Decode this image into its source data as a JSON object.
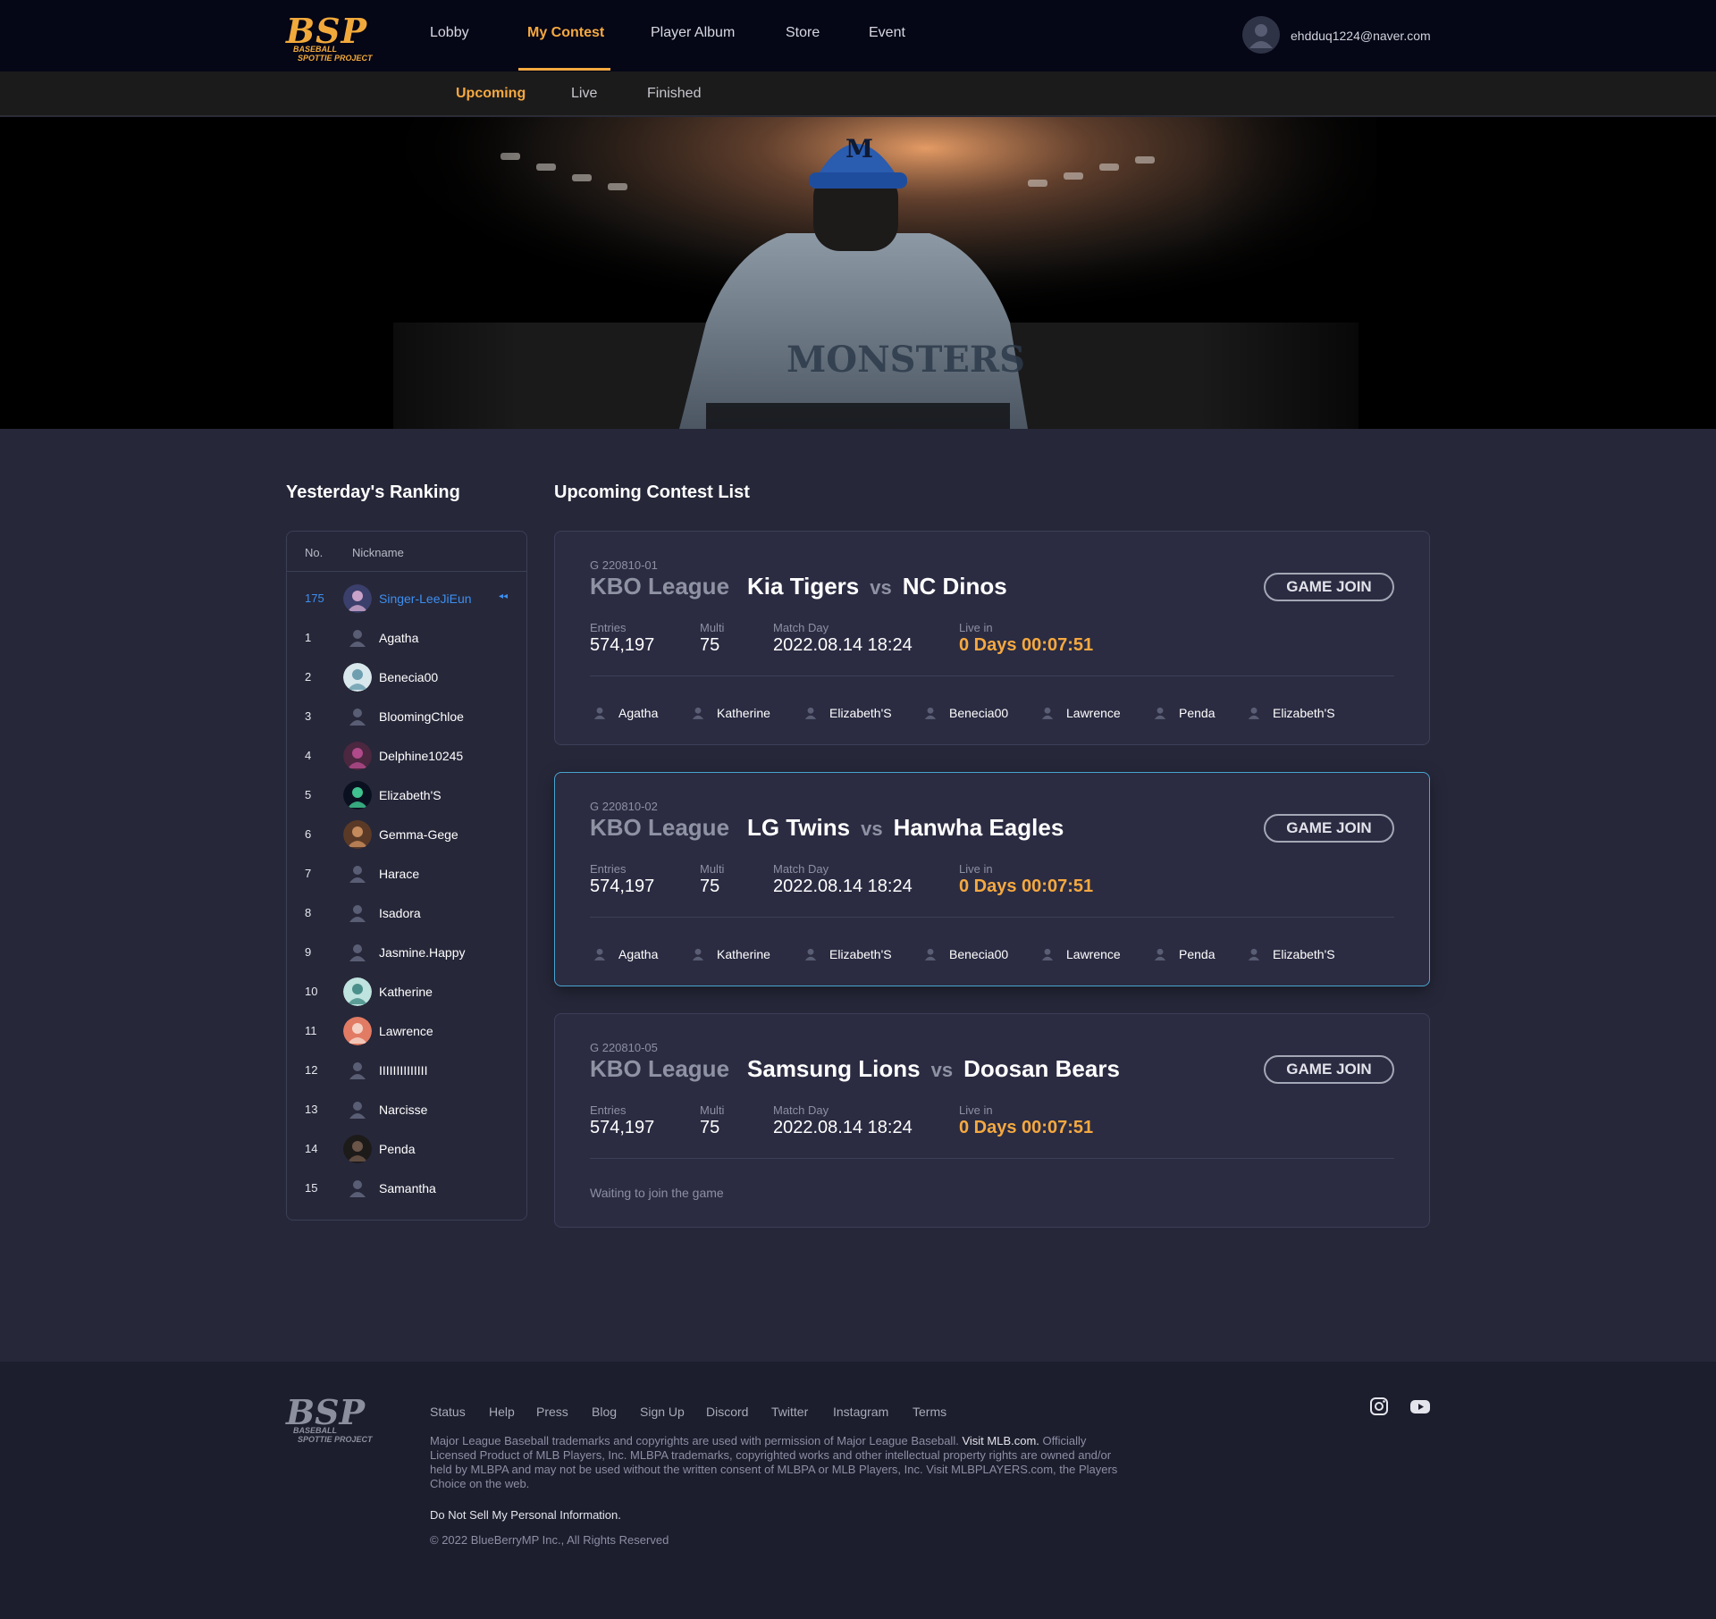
{
  "brand": {
    "logo": "BSP",
    "logo_sub": "BASEBALL\n  SPOTTIE PROJECT",
    "accent": "#f6a940",
    "blue": "#3d8ff0"
  },
  "nav": {
    "items": [
      {
        "label": "Lobby"
      },
      {
        "label": "My Contest"
      },
      {
        "label": "Player Album"
      },
      {
        "label": "Store"
      },
      {
        "label": "Event"
      }
    ],
    "active": "My Contest",
    "user_email": "ehdduq1224@naver.com",
    "user_icon": "user-avatar-icon"
  },
  "subnav": {
    "items": [
      {
        "label": "Upcoming"
      },
      {
        "label": "Live"
      },
      {
        "label": "Finished"
      }
    ],
    "active": "Upcoming"
  },
  "ranking": {
    "title": "Yesterday's Ranking",
    "col_no": "No.",
    "col_nickname": "Nickname",
    "me": {
      "no": "175",
      "nickname": "Singer-LeeJiEun",
      "marker": "◂◂"
    },
    "rows": [
      {
        "no": "1",
        "nickname": "Agatha",
        "avatar": "default-user-icon"
      },
      {
        "no": "2",
        "nickname": "Benecia00",
        "avatar": "photo"
      },
      {
        "no": "3",
        "nickname": "BloomingChloe",
        "avatar": "default-user-icon"
      },
      {
        "no": "4",
        "nickname": "Delphine10245",
        "avatar": "photo"
      },
      {
        "no": "5",
        "nickname": "Elizabeth'S",
        "avatar": "photo"
      },
      {
        "no": "6",
        "nickname": "Gemma-Gege",
        "avatar": "photo"
      },
      {
        "no": "7",
        "nickname": "Harace",
        "avatar": "default-user-icon"
      },
      {
        "no": "8",
        "nickname": "Isadora",
        "avatar": "default-user-icon"
      },
      {
        "no": "9",
        "nickname": "Jasmine.Happy",
        "avatar": "default-user-icon"
      },
      {
        "no": "10",
        "nickname": "Katherine",
        "avatar": "photo"
      },
      {
        "no": "11",
        "nickname": "Lawrence",
        "avatar": "photo"
      },
      {
        "no": "12",
        "nickname": "IIIIIIIIIIIIII",
        "avatar": "default-user-icon"
      },
      {
        "no": "13",
        "nickname": "Narcisse",
        "avatar": "default-user-icon"
      },
      {
        "no": "14",
        "nickname": "Penda",
        "avatar": "photo"
      },
      {
        "no": "15",
        "nickname": "Samantha",
        "avatar": "default-user-icon"
      }
    ]
  },
  "contests": {
    "title": "Upcoming Contest List",
    "labels": {
      "entries": "Entries",
      "multi": "Multi",
      "match_day": "Match Day",
      "live_in": "Live in",
      "vs": "vs",
      "join": "GAME JOIN"
    },
    "items": [
      {
        "id": "G 220810-01",
        "league": "KBO League",
        "team1": "Kia Tigers",
        "team2": "NC Dinos",
        "entries": "574,197",
        "multi": "75",
        "match_day": "2022.08.14 18:24",
        "live_in": "0 Days 00:07:51",
        "participants": [
          "Agatha",
          "Katherine",
          "Elizabeth'S",
          "Benecia00",
          "Lawrence",
          "Penda",
          "Elizabeth'S"
        ]
      },
      {
        "id": "G 220810-02",
        "league": "KBO League",
        "team1": "LG Twins",
        "team2": "Hanwha Eagles",
        "entries": "574,197",
        "multi": "75",
        "match_day": "2022.08.14 18:24",
        "live_in": "0 Days 00:07:51",
        "participants": [
          "Agatha",
          "Katherine",
          "Elizabeth'S",
          "Benecia00",
          "Lawrence",
          "Penda",
          "Elizabeth'S"
        ]
      },
      {
        "id": "G 220810-05",
        "league": "KBO League",
        "team1": "Samsung Lions",
        "team2": "Doosan Bears",
        "entries": "574,197",
        "multi": "75",
        "match_day": "2022.08.14 18:24",
        "live_in": "0 Days 00:07:51",
        "waiting": "Waiting to join the game"
      }
    ]
  },
  "footer": {
    "links": [
      "Status",
      "Help",
      "Press",
      "Blog",
      "Sign Up",
      "Discord",
      "Twitter",
      "Instagram",
      "Terms"
    ],
    "legal_1": "Major League Baseball trademarks and copyrights are used with permission of Major League Baseball.",
    "legal_link": "Visit MLB.com.",
    "legal_2": "Officially Licensed Product of MLB Players, Inc. MLBPA trademarks, copyrighted works and other intellectual property rights are owned and/or held by MLBPA and may not be used without the written consent of MLBPA or MLB Players, Inc. Visit MLBPLAYERS.com, the Players Choice on the web.",
    "do_not_sell": "Do Not Sell My Personal Information.",
    "copyright": "© 2022 BlueBerryMP Inc., All Rights Reserved",
    "social": [
      "instagram-icon",
      "youtube-icon"
    ]
  }
}
